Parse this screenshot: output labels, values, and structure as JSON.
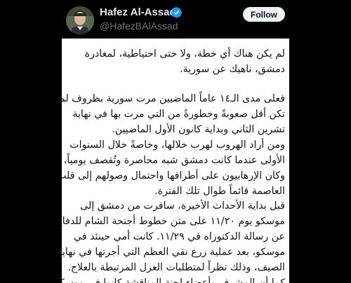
{
  "author": {
    "name": "Hafez Al-Assad",
    "handle": "@HafezBAlAssad",
    "verified": true,
    "avatar_icon": "person-portrait"
  },
  "follow_label": "Follow",
  "colors": {
    "background_dark": "#000000",
    "name_text": "#e7e9ea",
    "handle_text": "#71767b",
    "verified_blue": "#1d9bf0",
    "follow_bg": "#eff3f4",
    "body_text": "#0f1419"
  },
  "tweet": {
    "paragraphs": [
      {
        "lines": [
          "لم يكن هناك أي خطة، ولا حتى احتياطية، لمغادرة",
          "دمشق، ناهيك عن سورية."
        ]
      },
      {
        "lines": [
          "فعلى مدى الـ١٤ عاماً الماضيين مرت سورية بظروف لم",
          "تكن أقل صعوبةً وخطورةً من التي مرت بها في نهاية",
          "تشرين الثاني وبداية كانون الأول الماضيين.",
          "ومن أراد الهروب لهرب خلالها، وخاصةً خلال السنوات",
          "الأولى عندما كانت دمشق شبه محاصرة وتُقصف يومياً،",
          "وكان الإرهابيون على أطرافها واحتمال وصولهم إلى قلب",
          "العاصمة قائماً طوال تلك الفترة."
        ]
      },
      {
        "lines": [
          "قبل بداية الأحداث الأخيرة، سافرت من دمشق إلى",
          "موسكو يوم ١١/٢٠ على متن خطوط أجنحة الشام للدفاع",
          "عن رسالة الدكتوراه في ١١/٢٩. كانت أمي حينئذ في",
          "موسكو، بعد عملية زرع نقي العظم التي أجرتها في نهاية",
          "الصيف، وذلك نظراً لمتطلبات العزل المرتبطة بالعلاج.",
          "كما أن المشرف وأعضاء لجنة المناقشة كانوا في موسكو"
        ]
      }
    ]
  }
}
